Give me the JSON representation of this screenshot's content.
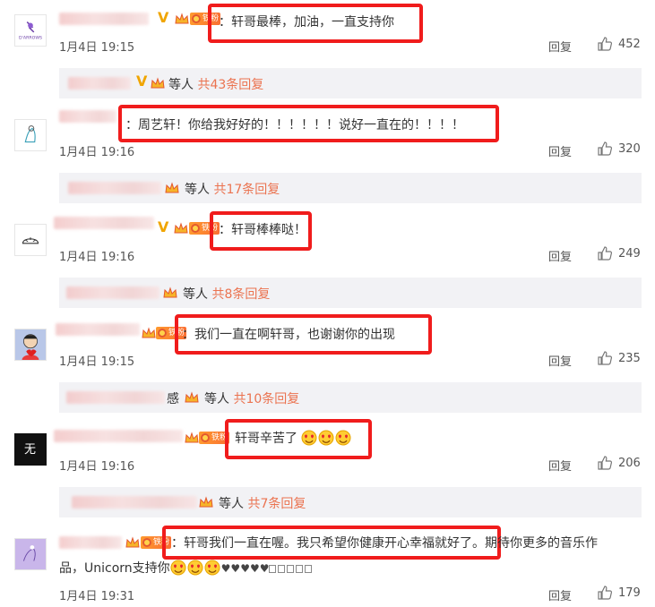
{
  "comments": [
    {
      "text": "：轩哥最棒，加油，一直支持你",
      "time": "1月4日 19:15",
      "reply_label": "回复",
      "likes": "452",
      "replies_people": "等人",
      "replies_count": "共43条回复",
      "avatar_icon": "d-arrows-logo-icon"
    },
    {
      "text": "：周艺轩！你给我好好的！！！！！！说好一直在的！！！！",
      "time": "1月4日 19:16",
      "reply_label": "回复",
      "likes": "320",
      "replies_people": "等人",
      "replies_count": "共17条回复",
      "avatar_icon": "sketch-figure-icon"
    },
    {
      "text": "：轩哥棒棒哒！",
      "time": "1月4日 19:16",
      "reply_label": "回复",
      "likes": "249",
      "replies_people": "等人",
      "replies_count": "共8条回复",
      "avatar_icon": "bun-doodle-icon"
    },
    {
      "text": "：我们一直在啊轩哥，也谢谢你的出现",
      "time": "1月4日 19:15",
      "reply_label": "回复",
      "likes": "235",
      "replies_people": "等人",
      "replies_count": "共10条回复",
      "replies_prefix": "感",
      "avatar_icon": "cartoon-boy-icon"
    },
    {
      "text": "轩哥辛苦了",
      "time": "1月4日 19:16",
      "reply_label": "回复",
      "likes": "206",
      "replies_people": "等人",
      "replies_count": "共7条回复",
      "avatar_icon": "dark-text-avatar-icon",
      "avatar_glyph": "无"
    },
    {
      "text_line1_highlighted": "：轩哥我们一直在喔。我只希望你健康开心幸福就好了。",
      "text_line1_rest": "期待你更多的音乐作",
      "text_line2": "品，Unicorn支持你",
      "time": "1月4日 19:31",
      "reply_label": "回复",
      "likes": "179",
      "avatar_icon": "purple-sketch-icon"
    }
  ],
  "badges": {
    "fan_badge_label": "铁粉",
    "vip_mark": "V"
  },
  "colors": {
    "highlight_red": "#f01c1c",
    "reply_count_orange": "#eb7350",
    "reply_bar_bg": "#f2f2f5",
    "vip_gold": "#f0a500"
  }
}
